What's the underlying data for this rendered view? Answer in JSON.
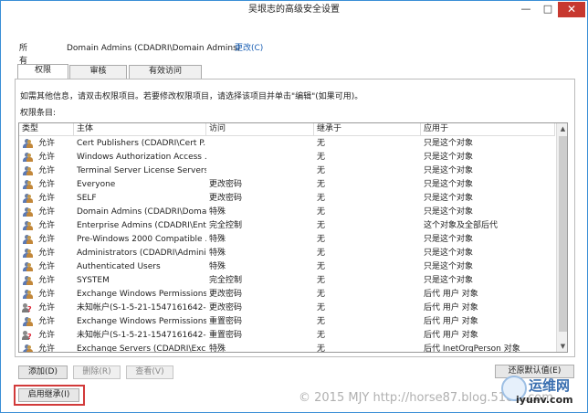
{
  "window": {
    "title": "吴垠志的高级安全设置",
    "minimize_glyph": "—",
    "maximize_glyph": "□",
    "close_glyph": "✕"
  },
  "owner": {
    "label": "所有者:",
    "value": "Domain Admins (CDADRI\\Domain Admins)",
    "change_link": "更改(C)"
  },
  "tabs": [
    {
      "label": "权限",
      "active": true
    },
    {
      "label": "审核",
      "active": false
    },
    {
      "label": "有效访问",
      "active": false
    }
  ],
  "permissions": {
    "info_text": "如需其他信息，请双击权限项目。若要修改权限项目，请选择该项目并单击\"编辑\"(如果可用)。",
    "entries_label": "权限条目:",
    "columns": [
      "类型",
      "主体",
      "访问",
      "继承于",
      "应用于"
    ],
    "rows": [
      {
        "icon": "group-icon",
        "type": "允许",
        "principal": "Cert Publishers (CDADRI\\Cert P...",
        "access": "",
        "inherited": "无",
        "applies": "只是这个对象"
      },
      {
        "icon": "group-icon",
        "type": "允许",
        "principal": "Windows Authorization Access ...",
        "access": "",
        "inherited": "无",
        "applies": "只是这个对象"
      },
      {
        "icon": "group-icon",
        "type": "允许",
        "principal": "Terminal Server License Servers...",
        "access": "",
        "inherited": "无",
        "applies": "只是这个对象"
      },
      {
        "icon": "group-icon",
        "type": "允许",
        "principal": "Everyone",
        "access": "更改密码",
        "inherited": "无",
        "applies": "只是这个对象"
      },
      {
        "icon": "group-icon",
        "type": "允许",
        "principal": "SELF",
        "access": "更改密码",
        "inherited": "无",
        "applies": "只是这个对象"
      },
      {
        "icon": "group-icon",
        "type": "允许",
        "principal": "Domain Admins (CDADRI\\Doma...",
        "access": "特殊",
        "inherited": "无",
        "applies": "只是这个对象"
      },
      {
        "icon": "group-icon",
        "type": "允许",
        "principal": "Enterprise Admins (CDADRI\\Ent...",
        "access": "完全控制",
        "inherited": "无",
        "applies": "这个对象及全部后代"
      },
      {
        "icon": "group-icon",
        "type": "允许",
        "principal": "Pre-Windows 2000 Compatible ...",
        "access": "特殊",
        "inherited": "无",
        "applies": "只是这个对象"
      },
      {
        "icon": "group-icon",
        "type": "允许",
        "principal": "Administrators (CDADRI\\Admini...",
        "access": "特殊",
        "inherited": "无",
        "applies": "只是这个对象"
      },
      {
        "icon": "group-icon",
        "type": "允许",
        "principal": "Authenticated Users",
        "access": "特殊",
        "inherited": "无",
        "applies": "只是这个对象"
      },
      {
        "icon": "group-icon",
        "type": "允许",
        "principal": "SYSTEM",
        "access": "完全控制",
        "inherited": "无",
        "applies": "只是这个对象"
      },
      {
        "icon": "group-icon",
        "type": "允许",
        "principal": "Exchange Windows Permissions...",
        "access": "更改密码",
        "inherited": "无",
        "applies": "后代 用户 对象"
      },
      {
        "icon": "unknown-account-icon",
        "type": "允许",
        "principal": "未知帐户(S-1-5-21-1547161642-...",
        "access": "更改密码",
        "inherited": "无",
        "applies": "后代 用户 对象"
      },
      {
        "icon": "group-icon",
        "type": "允许",
        "principal": "Exchange Windows Permissions...",
        "access": "重置密码",
        "inherited": "无",
        "applies": "后代 用户 对象"
      },
      {
        "icon": "unknown-account-icon",
        "type": "允许",
        "principal": "未知帐户(S-1-5-21-1547161642-...",
        "access": "重置密码",
        "inherited": "无",
        "applies": "后代 用户 对象"
      },
      {
        "icon": "group-icon",
        "type": "允许",
        "principal": "Exchange Servers (CDADRI\\Exc...",
        "access": "特殊",
        "inherited": "无",
        "applies": "后代 InetOrgPerson 对象"
      }
    ]
  },
  "buttons": {
    "add": "添加(D)",
    "remove": "删除(R)",
    "view": "查看(V)",
    "restore_defaults": "还原默认值(E)",
    "enable_inheritance": "启用继承(I)"
  },
  "watermark": {
    "text": "© 2015 MJY http://horse87.blog.51cto.com",
    "logo_cn": "运维网",
    "logo_en": "iyunv.com"
  },
  "colors": {
    "highlight": "#d23a3a",
    "link": "#1a5fb4",
    "close_button": "#c7382f"
  }
}
